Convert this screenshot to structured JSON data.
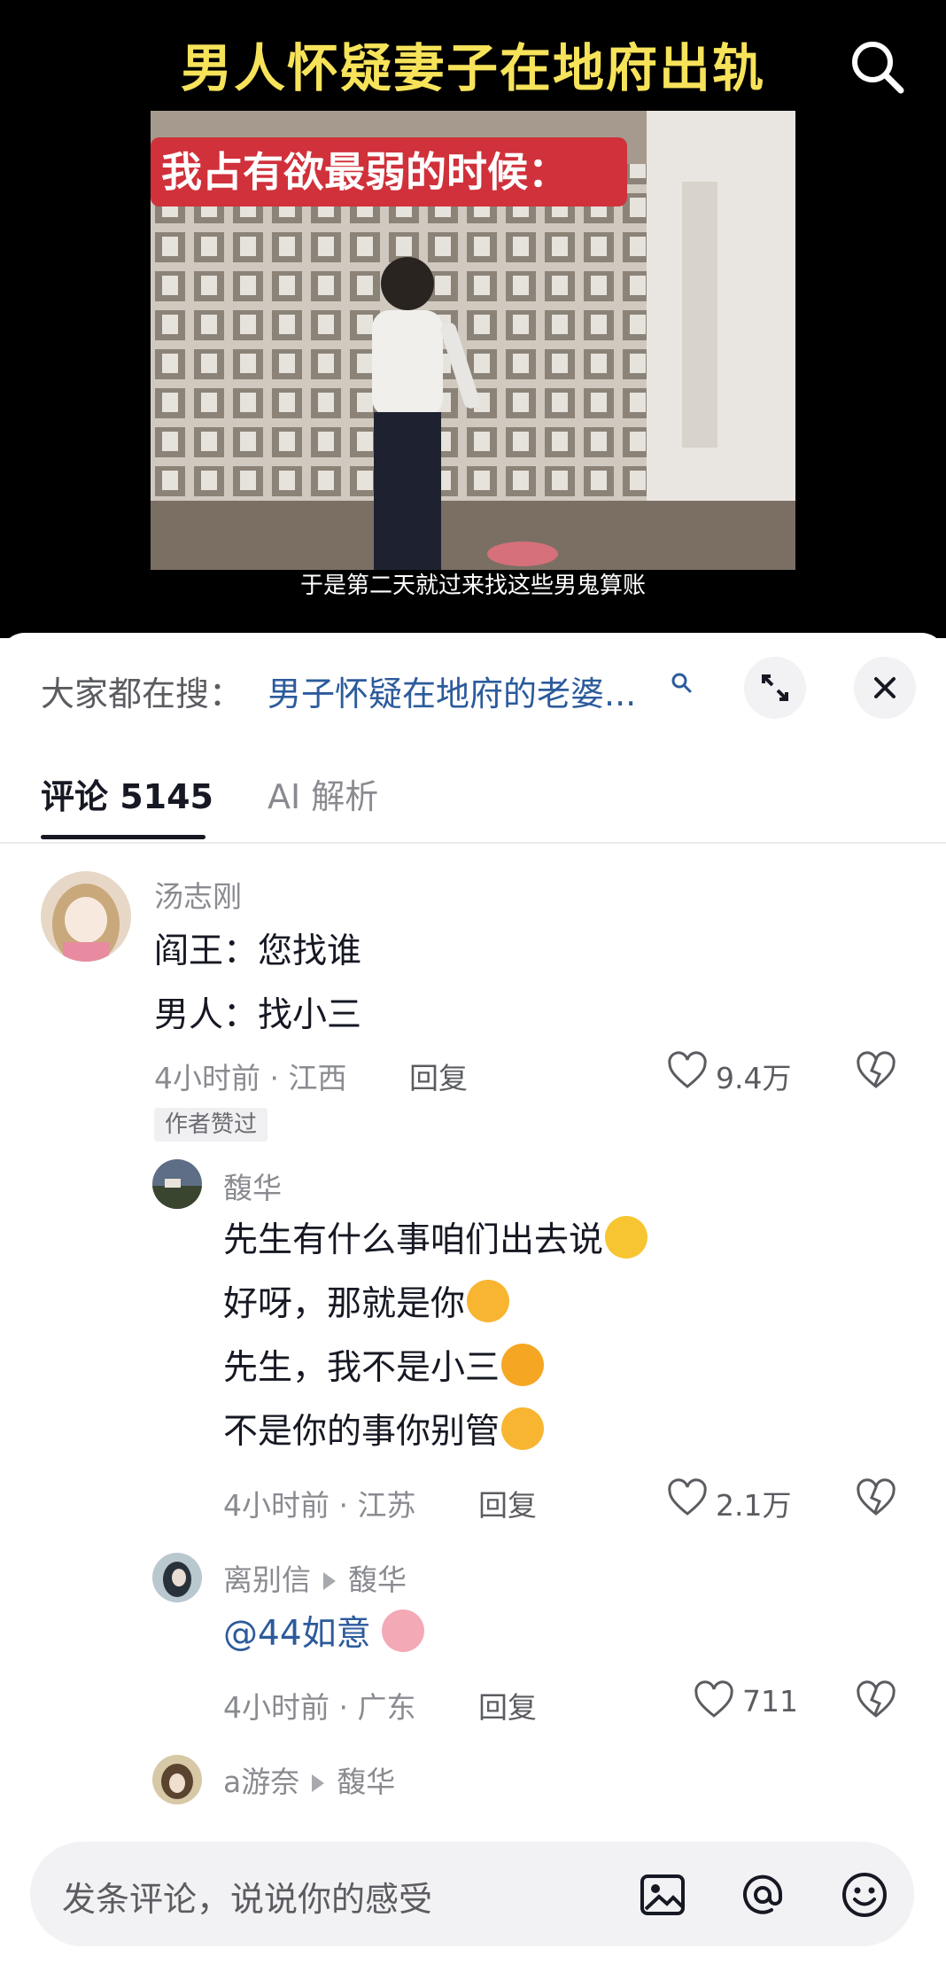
{
  "video": {
    "title": "男人怀疑妻子在地府出轨",
    "caption_tag": "我占有欲最弱的时候：",
    "subtitle": "于是第二天就过来找这些男鬼算账"
  },
  "search": {
    "prefix": "大家都在搜：",
    "query": "男子怀疑在地府的老婆..."
  },
  "tabs": {
    "comments": "评论 5145",
    "ai": "AI 解析"
  },
  "comments": [
    {
      "user": "汤志刚",
      "lines": [
        "阎王：您找谁",
        "男人：找小三"
      ],
      "meta": "4小时前 · 江西",
      "reply": "回复",
      "likes": "9.4万",
      "badge": "作者赞过"
    },
    {
      "user": "馥华",
      "lines": [
        "先生有什么事咱们出去说",
        "好呀，那就是你",
        "先生，我不是小三",
        "不是你的事你别管"
      ],
      "meta": "4小时前 · 江苏",
      "reply": "回复",
      "likes": "2.1万"
    },
    {
      "user": "离别信",
      "reply_to": "馥华",
      "lines": [
        "@44如意"
      ],
      "meta": "4小时前 · 广东",
      "reply": "回复",
      "likes": "711"
    },
    {
      "user": "a游奈",
      "reply_to": "馥华"
    }
  ],
  "input": {
    "placeholder": "发条评论，说说你的感受"
  },
  "colors": {
    "title_yellow": "#f7e35a",
    "caption_red": "#d0313b",
    "link_blue": "#2c5b9c"
  }
}
